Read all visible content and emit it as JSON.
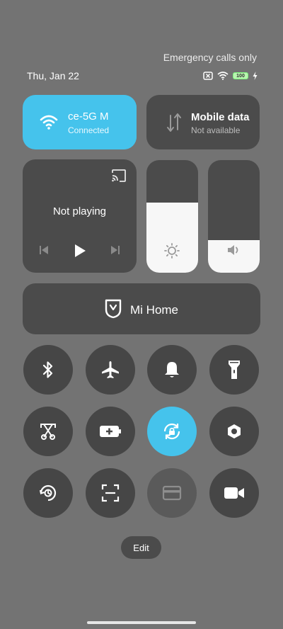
{
  "status_bar": {
    "emergency_text": "Emergency calls only",
    "date": "Thu, Jan 22",
    "battery_level": "100"
  },
  "tiles": {
    "wifi": {
      "name": "ce-5G  M",
      "status": "Connected",
      "active": true,
      "color": "#45c3ec"
    },
    "mobile_data": {
      "title": "Mobile data",
      "status": "Not available"
    },
    "media": {
      "title": "Not playing"
    },
    "brightness": {
      "level": 0.62
    },
    "volume": {
      "level": 0.29
    },
    "mi_home": {
      "label": "Mi Home"
    }
  },
  "toggles": [
    {
      "name": "bluetooth-icon",
      "on": false
    },
    {
      "name": "airplane-icon",
      "on": false
    },
    {
      "name": "bell-icon",
      "on": false
    },
    {
      "name": "flashlight-icon",
      "on": false
    },
    {
      "name": "screenshot-icon",
      "on": false
    },
    {
      "name": "battery-saver-icon",
      "on": false
    },
    {
      "name": "rotation-lock-icon",
      "on": true
    },
    {
      "name": "hexagon-icon",
      "on": false
    },
    {
      "name": "reading-mode-icon",
      "on": false
    },
    {
      "name": "scanner-icon",
      "on": false
    },
    {
      "name": "card-icon",
      "on": false
    },
    {
      "name": "video-camera-icon",
      "on": false
    }
  ],
  "edit_label": "Edit",
  "colors": {
    "background": "#737373",
    "tile": "#4b4b4b",
    "accent": "#45c3ec"
  }
}
